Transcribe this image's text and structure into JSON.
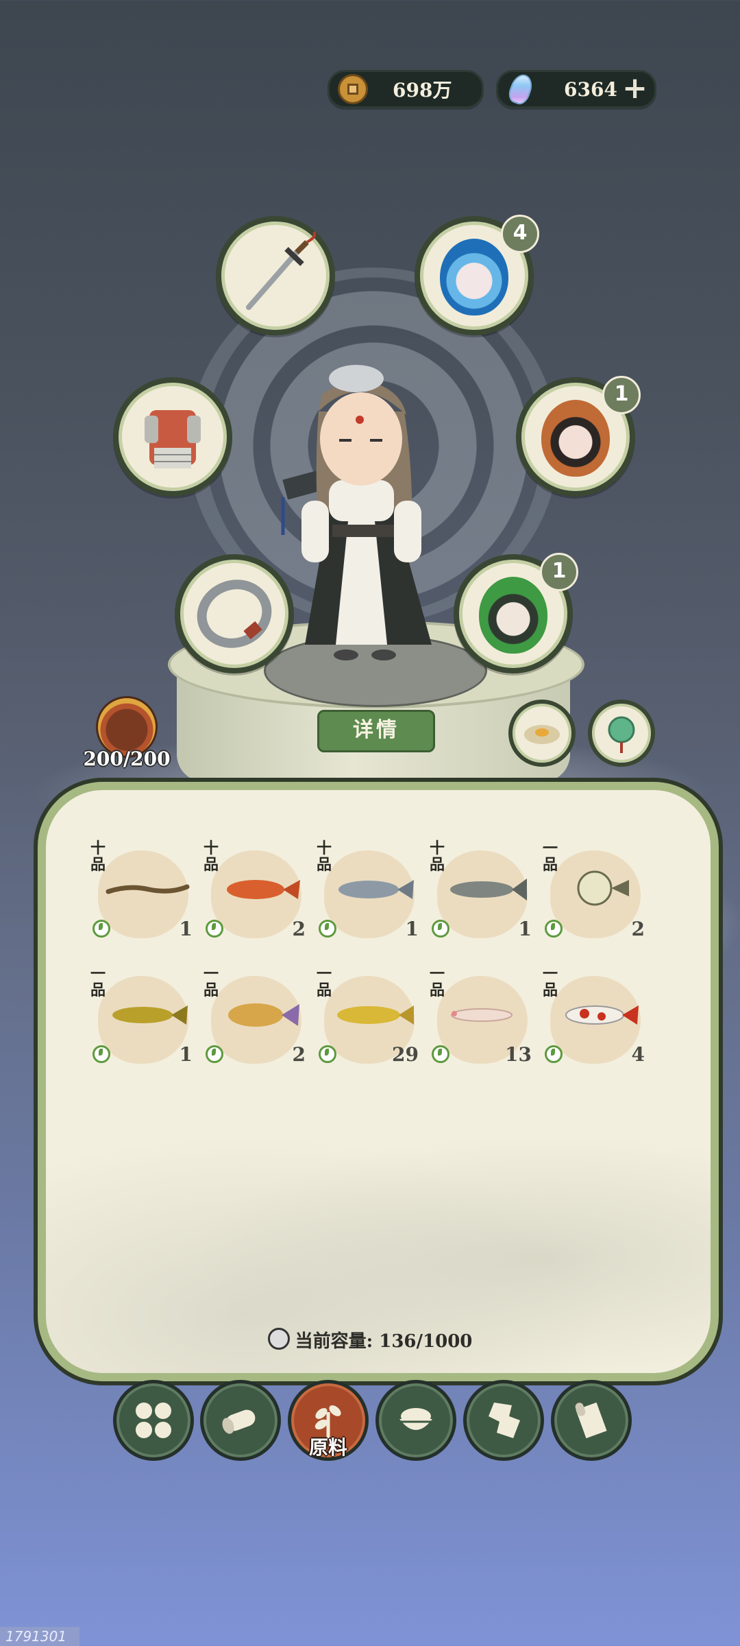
{
  "currency": {
    "coins": "698万",
    "gems": "6364"
  },
  "equipment": {
    "weapon_badge": null,
    "spirit_top_count": "4",
    "spirit_mid_count": "1",
    "spirit_low_count": "1"
  },
  "detail_button": "详情",
  "stamina": "200/200",
  "inventory": {
    "items": [
      {
        "grade": "十\n品",
        "qty": "1",
        "fish": "eel"
      },
      {
        "grade": "十\n品",
        "qty": "2",
        "fish": "red-carp"
      },
      {
        "grade": "十\n品",
        "qty": "1",
        "fish": "silver-fish"
      },
      {
        "grade": "十\n品",
        "qty": "1",
        "fish": "catfish-gray"
      },
      {
        "grade": "一\n品",
        "qty": "2",
        "fish": "pufferfish"
      },
      {
        "grade": "一\n品",
        "qty": "1",
        "fish": "yellow-catfish"
      },
      {
        "grade": "一\n品",
        "qty": "2",
        "fish": "rainbow-fish"
      },
      {
        "grade": "一\n品",
        "qty": "29",
        "fish": "golden-arowana"
      },
      {
        "grade": "一\n品",
        "qty": "13",
        "fish": "axolotl"
      },
      {
        "grade": "一\n品",
        "qty": "4",
        "fish": "koi"
      }
    ],
    "capacity_label": "当前容量: 136/1000"
  },
  "tabs": [
    {
      "icon": "grid-icon",
      "label": ""
    },
    {
      "icon": "wood-log-icon",
      "label": ""
    },
    {
      "icon": "sprout-icon",
      "label": "原料"
    },
    {
      "icon": "rice-bowl-icon",
      "label": ""
    },
    {
      "icon": "map-piece-icon",
      "label": ""
    },
    {
      "icon": "scroll-icon",
      "label": ""
    }
  ],
  "uid": "1791301"
}
